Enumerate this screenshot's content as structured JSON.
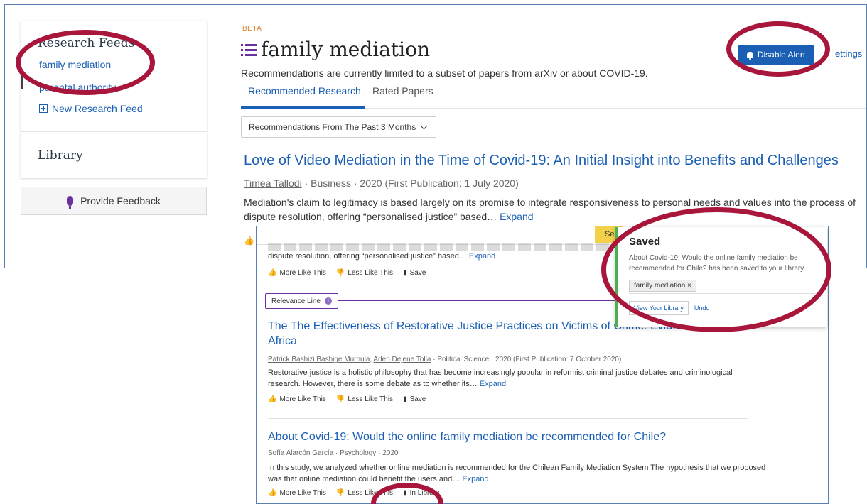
{
  "sidebar": {
    "heading": "Research Feeds",
    "feeds": [
      "family mediation",
      "parental authority"
    ],
    "new_feed_label": "New Research Feed",
    "library_label": "Library",
    "feedback_label": "Provide Feedback"
  },
  "header": {
    "beta": "BETA",
    "title": "family mediation",
    "subtitle": "Recommendations are currently limited to a subset of papers from arXiv or about COVID-19.",
    "tabs": [
      "Recommended Research",
      "Rated Papers"
    ],
    "filter": "Recommendations From The Past 3 Months",
    "disable_alert": "Disable Alert",
    "settings": "ettings"
  },
  "paper1": {
    "title": "Love of Video Mediation in the Time of Covid-19: An Initial Insight into Benefits and Challenges",
    "author": "Timea Tallodi",
    "field": "Business",
    "year": "2020 (First Publication: 1 July 2020)",
    "abstract": "Mediation's claim to legitimacy is based largely on its promise to integrate responsiveness to personal needs and values into the process of dispute resolution, offering “personalised justice” based…",
    "expand": "Expand"
  },
  "zoom": {
    "search_stub": "Se",
    "prev_abstract_tail": "dispute resolution, offering “personalised justice” based…",
    "expand": "Expand",
    "more_like": "More Like This",
    "less_like": "Less Like This",
    "save": "Save",
    "in_library": "In Library",
    "relevance": "Relevance Line",
    "paper2": {
      "title_line1": "The The Effectiveness of Restorative Justice Practices on Victims of Crime: Evidence fr",
      "title_line2": "Africa",
      "author1": "Patrick Bashizi Bashige Murhula",
      "author2": "Aden Dejene Tolla",
      "meta": "Political Science · 2020 (First Publication: 7 October 2020)",
      "abstract_l1": "Restorative justice is a holistic philosophy that has become increasingly popular in reformist criminal justice debates and criminological",
      "abstract_l2": "research. However, there is some debate as to whether its…"
    },
    "paper3": {
      "title": "About Covid-19: Would the online family mediation be recommended for Chile?",
      "author": "Sofía Alarcón García",
      "meta": "Psychology · 2020",
      "abstract_l1": "In this study, we analyzed whether online mediation is recommended for the Chilean Family Mediation System The hypothesis that we proposed",
      "abstract_l2": "was that online mediation could benefit the users and…"
    }
  },
  "saved_panel": {
    "title": "Saved",
    "message": "About Covid-19: Would the online family mediation be recommended for Chile? has been saved to your library.",
    "tag": "family mediation",
    "view_library": "View Your Library",
    "undo": "Undo"
  },
  "colors": {
    "accent": "#1a5fb4",
    "purple": "#6b2fa0",
    "highlight": "#a8163c",
    "frame": "#5a7fb2"
  }
}
